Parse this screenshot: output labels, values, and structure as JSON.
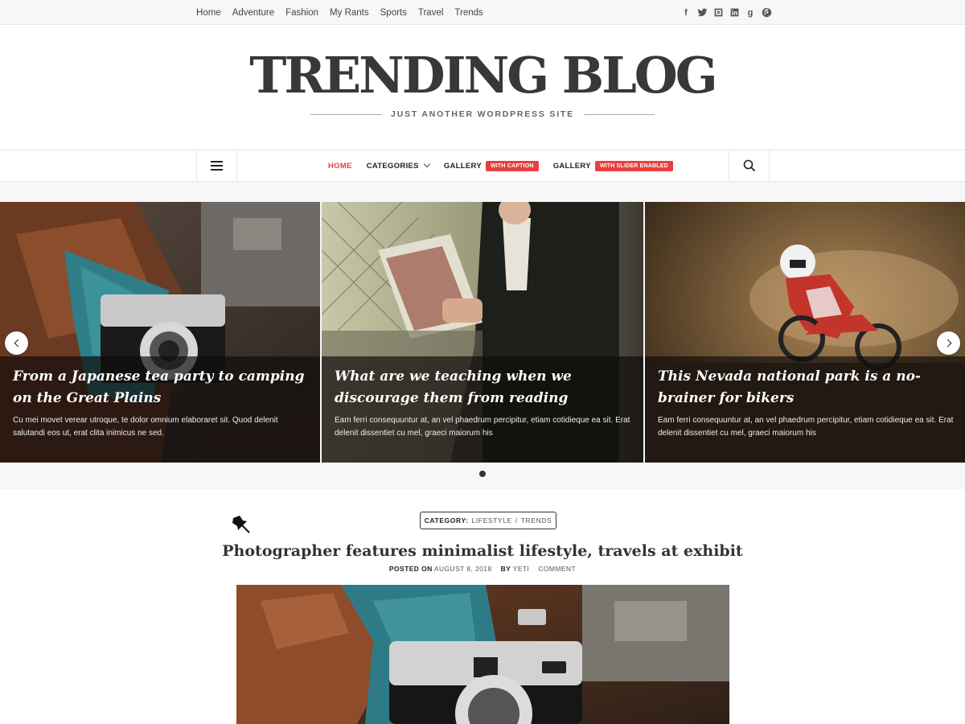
{
  "topbar": {
    "nav": [
      "Home",
      "Adventure",
      "Fashion",
      "My Rants",
      "Sports",
      "Travel",
      "Trends"
    ],
    "social": [
      {
        "icon": "facebook-icon",
        "glyph": "f"
      },
      {
        "icon": "twitter-icon",
        "glyph": ""
      },
      {
        "icon": "instagram-icon",
        "glyph": ""
      },
      {
        "icon": "linkedin-icon",
        "glyph": "in"
      },
      {
        "icon": "google-plus-icon",
        "glyph": "g"
      },
      {
        "icon": "pinterest-icon",
        "glyph": ""
      }
    ]
  },
  "brand": {
    "title": "TRENDING BLOG",
    "tagline": "JUST ANOTHER WORDPRESS SITE"
  },
  "mainnav": {
    "home": "HOME",
    "categories": "CATEGORIES",
    "gallery1": "GALLERY",
    "gallery1_badge": "WITH CAPTION",
    "gallery2": "GALLERY",
    "gallery2_badge": "WITH SLIDER ENABLED",
    "icons": {
      "menu": "hamburger-icon",
      "search": "search-icon"
    }
  },
  "slider": {
    "slides": [
      {
        "title": "From a Japanese tea party to camping on the Great Plains",
        "excerpt": "Cu mei movet verear utroque, te dolor omnium elaboraret sit. Quod delenit salutandi eos ut, erat clita inimicus ne sed."
      },
      {
        "title": "What are we teaching when we discourage them from reading",
        "excerpt": "Eam ferri consequuntur at, an vel phaedrum percipitur, etiam cotidieque ea sit. Erat delenit dissentiet cu mel, graeci maiorum his"
      },
      {
        "title": "This Nevada national park is a no-brainer for bikers",
        "excerpt": "Eam ferri consequuntur at, an vel phaedrum percipitur, etiam cotidieque ea sit. Erat delenit dissentiet cu mel, graeci maiorum his"
      }
    ],
    "icons": {
      "prev": "chevron-left-icon",
      "next": "chevron-right-icon"
    }
  },
  "post": {
    "category_label": "CATEGORY:",
    "category1": "LIFESTYLE",
    "separator": "/",
    "category2": "TRENDS",
    "title": "Photographer features minimalist lifestyle, travels at exhibit",
    "posted_on": "POSTED ON",
    "date": "AUGUST 8, 2018",
    "by": "BY",
    "author": "YETI",
    "comment": "COMMENT",
    "sticky_icon": "pushpin-icon"
  },
  "colors": {
    "accent": "#e8403e",
    "text": "#333333",
    "topbar_bg": "#f7f7f8"
  }
}
